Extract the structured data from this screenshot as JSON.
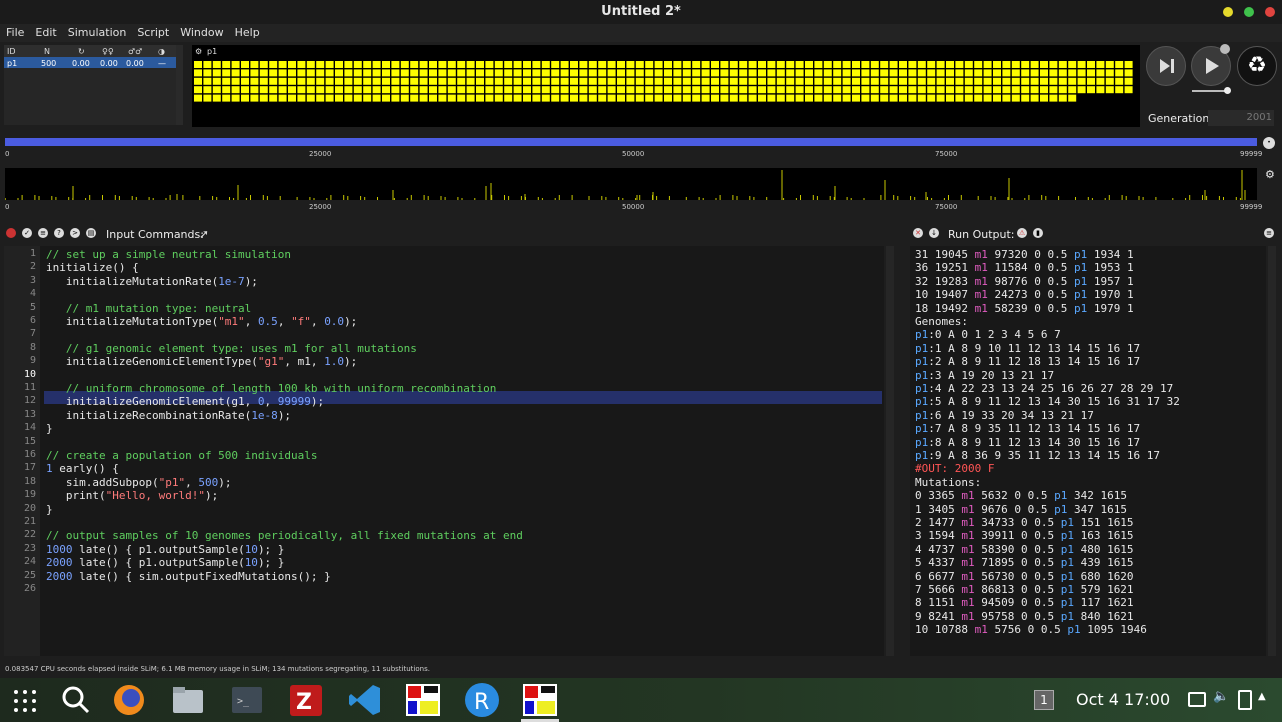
{
  "window": {
    "title": "Untitled 2*"
  },
  "menu": [
    "File",
    "Edit",
    "Simulation",
    "Script",
    "Window",
    "Help"
  ],
  "population_table": {
    "headers": [
      "ID",
      "N",
      "↻",
      "♀♀",
      "♂♂",
      "◑"
    ],
    "rows": [
      {
        "id": "p1",
        "n": "500",
        "c1": "0.00",
        "c2": "0.00",
        "c3": "0.00",
        "c4": "—"
      }
    ]
  },
  "genome_view": {
    "label": "p1",
    "cell_color": "#ffff00",
    "filled_rows_fraction_last": 0.942
  },
  "controls": {
    "step_icon": "step-forward-icon",
    "play_icon": "play-icon",
    "recycle_icon": "recycle-icon",
    "generation_label": "Generation:",
    "generation_value": "2001"
  },
  "chromosome": {
    "ticks": [
      "0",
      "25000",
      "50000",
      "75000",
      "99999"
    ],
    "bar_color": "#4b5ce0",
    "mutation_color": "#c8c800"
  },
  "input_panel": {
    "title": "Input Commands:",
    "code": [
      "// set up a simple neutral simulation",
      "initialize() {",
      "   initializeMutationRate(1e-7);",
      "",
      "   // m1 mutation type: neutral",
      "   initializeMutationType(\"m1\", 0.5, \"f\", 0.0);",
      "",
      "   // g1 genomic element type: uses m1 for all mutations",
      "   initializeGenomicElementType(\"g1\", m1, 1.0);",
      "",
      "   // uniform chromosome of length 100 kb with uniform recombination",
      "   initializeGenomicElement(g1, 0, 99999);",
      "   initializeRecombinationRate(1e-8);",
      "}",
      "",
      "// create a population of 500 individuals",
      "1 early() {",
      "   sim.addSubpop(\"p1\", 500);",
      "   print(\"Hello, world!\");",
      "}",
      "",
      "// output samples of 10 genomes periodically, all fixed mutations at end",
      "1000 late() { p1.outputSample(10); }",
      "2000 late() { p1.outputSample(10); }",
      "2000 late() { sim.outputFixedMutations(); }",
      ""
    ]
  },
  "output_panel": {
    "title": "Run Output:",
    "lines": [
      "31 19045 m1 97320 0 0.5 p1 1934 1",
      "36 19251 m1 11584 0 0.5 p1 1953 1",
      "32 19283 m1 98776 0 0.5 p1 1957 1",
      "10 19407 m1 24273 0 0.5 p1 1970 1",
      "18 19492 m1 58239 0 0.5 p1 1979 1",
      "Genomes:",
      "p1:0 A 0 1 2 3 4 5 6 7",
      "p1:1 A 8 9 10 11 12 13 14 15 16 17",
      "p1:2 A 8 9 11 12 18 13 14 15 16 17",
      "p1:3 A 19 20 13 21 17",
      "p1:4 A 22 23 13 24 25 16 26 27 28 29 17",
      "p1:5 A 8 9 11 12 13 14 30 15 16 31 17 32",
      "p1:6 A 19 33 20 34 13 21 17",
      "p1:7 A 8 9 35 11 12 13 14 15 16 17",
      "p1:8 A 8 9 11 12 13 14 30 15 16 17",
      "p1:9 A 8 36 9 35 11 12 13 14 15 16 17",
      "#OUT: 2000 F",
      "Mutations:",
      "0 3365 m1 5632 0 0.5 p1 342 1615",
      "1 3405 m1 9676 0 0.5 p1 347 1615",
      "2 1477 m1 34733 0 0.5 p1 151 1615",
      "3 1594 m1 39911 0 0.5 p1 163 1615",
      "4 4737 m1 58390 0 0.5 p1 480 1615",
      "5 4337 m1 71895 0 0.5 p1 439 1615",
      "6 6677 m1 56730 0 0.5 p1 680 1620",
      "7 5666 m1 86813 0 0.5 p1 579 1621",
      "8 1151 m1 94509 0 0.5 p1 117 1621",
      "9 8241 m1 95758 0 0.5 p1 840 1621",
      "10 10788 m1 5756 0 0.5 p1 1095 1946"
    ]
  },
  "status_bar": "0.083547 CPU seconds elapsed inside SLiM; 6.1 MB memory usage in SLiM; 134 mutations segregating, 11 substitutions.",
  "taskbar": {
    "apps": [
      "apps-grid-icon",
      "search-icon",
      "firefox-icon",
      "files-icon",
      "terminal-icon",
      "filezilla-icon",
      "vscode-icon",
      "slim-icon",
      "r-icon",
      "slim-gui-icon"
    ],
    "workspace": "1",
    "clock": "Oct 4  17:00"
  }
}
